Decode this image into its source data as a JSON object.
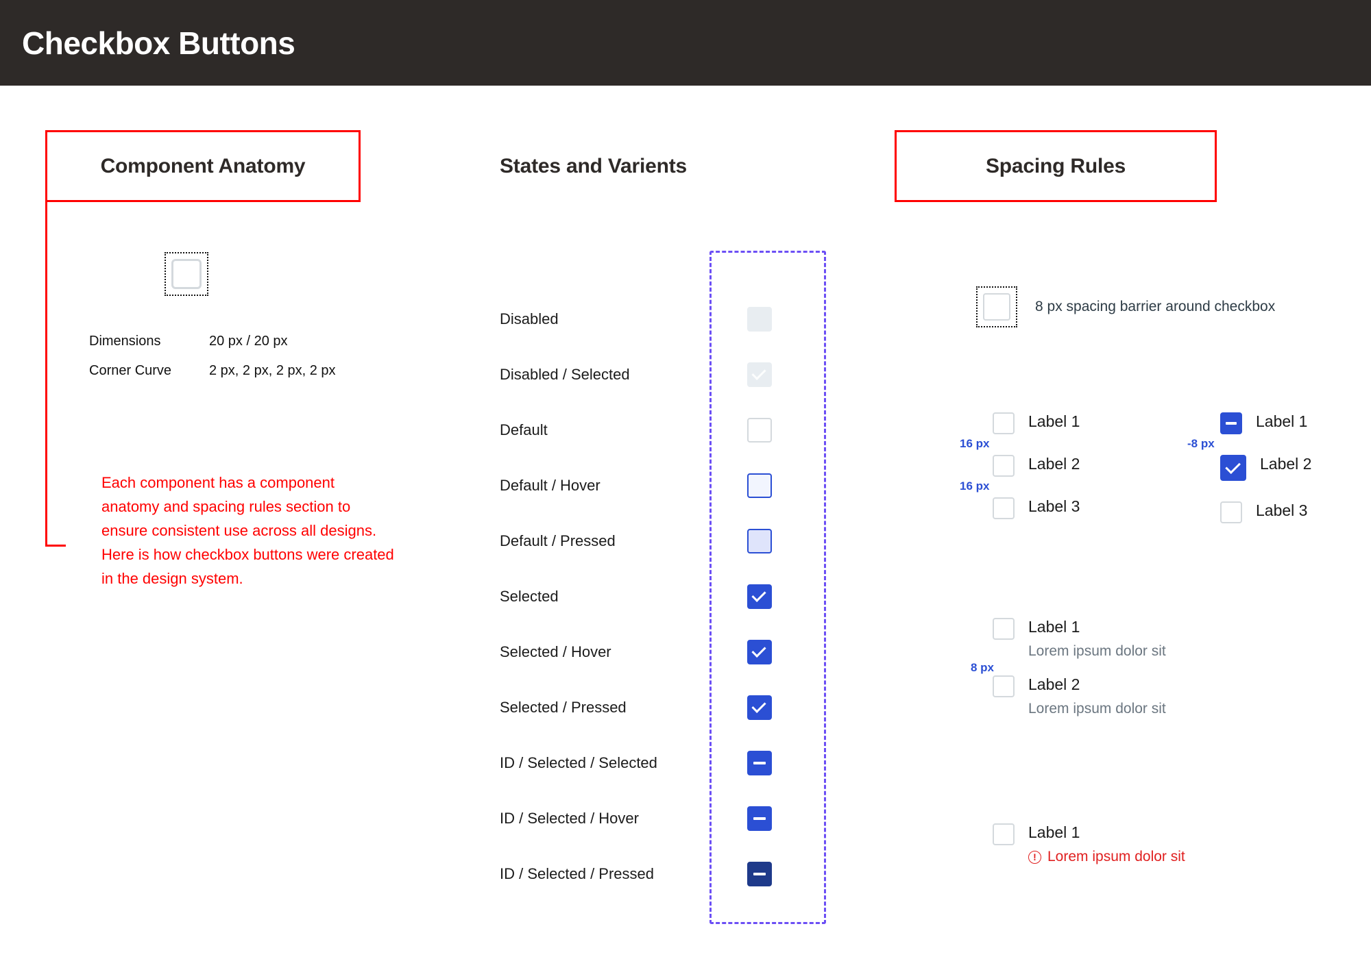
{
  "header": {
    "title": "Checkbox Buttons"
  },
  "sections": {
    "anatomy": {
      "title": "Component Anatomy"
    },
    "states": {
      "title": "States and Varients"
    },
    "spacing": {
      "title": "Spacing Rules"
    }
  },
  "anatomy": {
    "specs": [
      {
        "key": "Dimensions",
        "value": "20 px / 20 px"
      },
      {
        "key": "Corner Curve",
        "value": "2 px, 2 px, 2 px, 2 px"
      }
    ],
    "note": "Each component has a component anatomy and spacing rules section to ensure  consistent use across all designs. Here is how checkbox buttons were created in the design system."
  },
  "states": {
    "rows": [
      {
        "label": "Disabled",
        "variant": "disabled",
        "mark": "none"
      },
      {
        "label": "Disabled / Selected",
        "variant": "dis-sel",
        "mark": "check-grey"
      },
      {
        "label": "Default",
        "variant": "default",
        "mark": "none"
      },
      {
        "label": "Default / Hover",
        "variant": "hover",
        "mark": "none"
      },
      {
        "label": "Default / Pressed",
        "variant": "pressed",
        "mark": "none"
      },
      {
        "label": "Selected",
        "variant": "selected",
        "mark": "check"
      },
      {
        "label": "Selected / Hover",
        "variant": "selected",
        "mark": "check"
      },
      {
        "label": "Selected / Pressed",
        "variant": "selected",
        "mark": "check"
      },
      {
        "label": "ID / Selected / Selected",
        "variant": "selected",
        "mark": "dash"
      },
      {
        "label": "ID / Selected / Hover",
        "variant": "selected",
        "mark": "dash"
      },
      {
        "label": "ID / Selected / Pressed",
        "variant": "dark",
        "mark": "dash"
      }
    ]
  },
  "spacing": {
    "barrier_note": "8 px spacing barrier around checkbox",
    "group_a": {
      "items": [
        {
          "label": "Label 1",
          "variant": "default",
          "mark": "none"
        },
        {
          "label": "Label 2",
          "variant": "default",
          "mark": "none"
        },
        {
          "label": "Label 3",
          "variant": "default",
          "mark": "none"
        }
      ],
      "gaps": [
        "16 px",
        "16 px"
      ]
    },
    "group_b": {
      "items": [
        {
          "label": "Label 1",
          "variant": "selected",
          "mark": "dash"
        },
        {
          "label": "Label 2",
          "variant": "selected",
          "mark": "check"
        },
        {
          "label": "Label 3",
          "variant": "default",
          "mark": "none"
        }
      ],
      "gaps": [
        "-8 px",
        ""
      ]
    },
    "group_c": {
      "items": [
        {
          "label": "Label 1",
          "sub": "Lorem ipsum dolor sit",
          "variant": "default",
          "mark": "none"
        },
        {
          "label": "Label 2",
          "sub": "Lorem ipsum dolor sit",
          "variant": "default",
          "mark": "none"
        }
      ],
      "gaps": [
        "8 px"
      ]
    },
    "group_d": {
      "items": [
        {
          "label": "Label 1",
          "error": "Lorem ipsum dolor sit",
          "variant": "default",
          "mark": "none",
          "icon": "error-circle-icon"
        }
      ]
    }
  },
  "colors": {
    "header_bg": "#2e2a28",
    "accent_blue": "#2b4fd4",
    "dark_blue": "#1e3a8a",
    "annotation_red": "#ff0000",
    "error_red": "#e02020",
    "frame_purple": "#6c4ff5",
    "disabled_grey": "#e8edf1"
  }
}
